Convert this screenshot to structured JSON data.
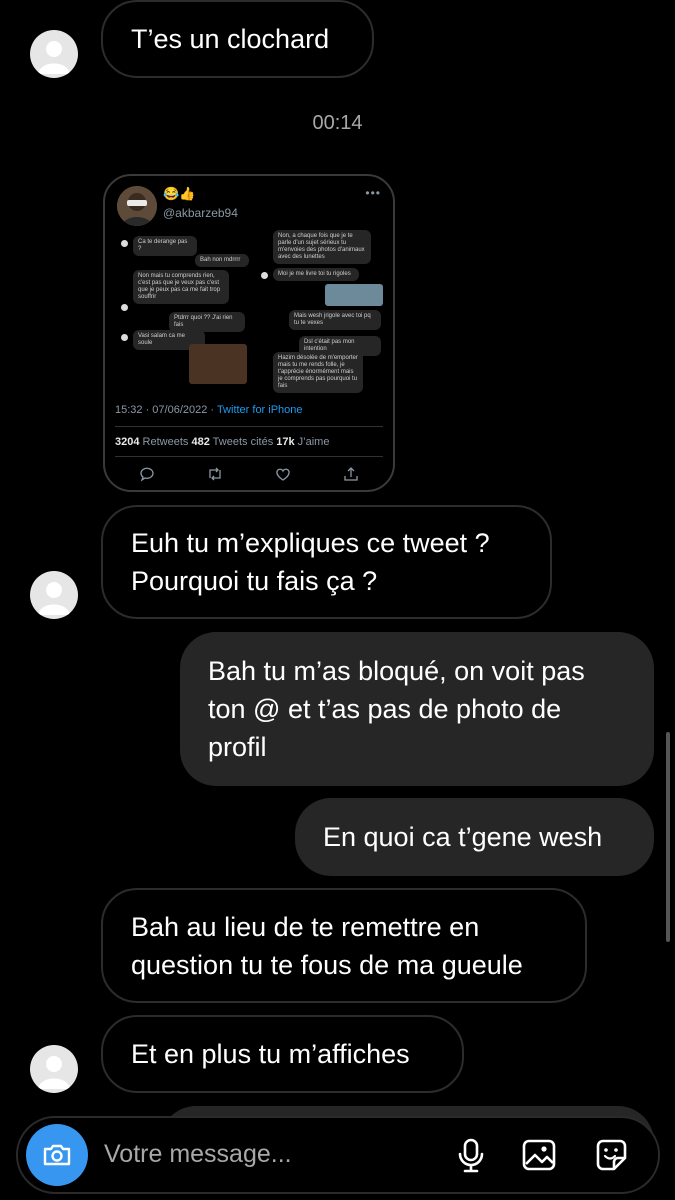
{
  "messages": [
    {
      "side": "in",
      "text": "T’es un clochard"
    },
    {
      "side": "in",
      "text": "Euh tu m’expliques ce tweet ?\nPourquoi tu fais ça ?"
    },
    {
      "side": "out",
      "text": "Bah tu m’as bloqué, on voit pas\nton @ et t’as pas de photo de\nprofil"
    },
    {
      "side": "out",
      "text": "En quoi ca t’gene wesh"
    },
    {
      "side": "in",
      "text": "Bah au lieu de te remettre en\nquestion tu te fous de ma gueule"
    },
    {
      "side": "in",
      "text": "Et en plus tu m’affiches"
    }
  ],
  "timestamp": "00:14",
  "tweet": {
    "emoji": "😂👍",
    "handle": "@akbarzeb94",
    "datetime": "15:32 · 07/06/2022 · ",
    "source": "Twitter for iPhone",
    "retweets_count": "3204",
    "retweets_label": " Retweets ",
    "quotes_count": "482",
    "quotes_label": " Tweets cités ",
    "likes_count": "17k",
    "likes_label": " J’aime",
    "mini_messages": [
      "Ca te derange pas ?",
      "Bah non mdrrrr",
      "Non mais tu comprends rien, c'est pas que je veux pas c'est que je peux pas ca me fait trop souffrir",
      "Ptdrrr quoi ?? J'ai rien fais",
      "Vasi salam ca me soule",
      "Non, a chaque fois que je te parle d'un sujet sérieux tu m'envoies des photos d'animaux avec des lunettes",
      "Moi je me livre toi tu rigoles",
      "Mais wesh jrigole avec toi pq tu te vexes",
      "Dsl c'était pas mon intention",
      "Hazim désolée de m'emporter mais tu me rends folle, je t'apprécie énormément mais je comprends pas pourquoi tu fais"
    ],
    "icons": [
      "reply-icon",
      "retweet-icon",
      "like-icon",
      "share-icon"
    ]
  },
  "composer": {
    "placeholder": "Votre message...",
    "icons": [
      "camera-icon",
      "microphone-icon",
      "gallery-icon",
      "sticker-icon"
    ]
  },
  "colors": {
    "background": "#000000",
    "outgoing_bubble": "#262626",
    "accent": "#3797f0",
    "twitter_link": "#1d9bf0"
  }
}
